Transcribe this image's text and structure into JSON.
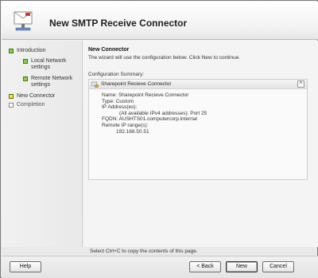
{
  "window": {
    "title": "New SMTP Receive Connector"
  },
  "nav": {
    "items": [
      {
        "label": "Introduction",
        "state": "complete"
      },
      {
        "label": "Local Network settings",
        "state": "complete"
      },
      {
        "label": "Remote Network settings",
        "state": "complete"
      },
      {
        "label": "New Connector",
        "state": "current"
      },
      {
        "label": "Completion",
        "state": "pending"
      }
    ]
  },
  "main": {
    "heading": "New Connector",
    "description": "The wizard will use the configuration below.  Click New to continue.",
    "summary_caption": "Configuration Summary:",
    "summary_title": "Sharepoint Recieve Connector",
    "summary_lines": {
      "name": "Name: Sharepoint Recieve Connector",
      "type": "Type: Custom",
      "ip_header": "IP Address(es):",
      "ip_value": "(All available IPv4 addresses): Port 25",
      "fqdn": "FQDN: AUSHTS01.computercorp.internal",
      "remote_header": "Remote IP range(s):",
      "remote_value": "192.168.50.51"
    },
    "copy_hint": "Select Ctrl+C to copy the contents of this page."
  },
  "buttons": {
    "help": "Help",
    "back": "< Back",
    "new": "New",
    "cancel": "Cancel"
  },
  "colors": {
    "complete_marker": "#8ccf3e",
    "current_marker": "#f2e93a"
  },
  "icons": {
    "header": "envelope-connector-icon",
    "summary": "connector-icon",
    "collapse": "double-chevron-up-icon"
  }
}
